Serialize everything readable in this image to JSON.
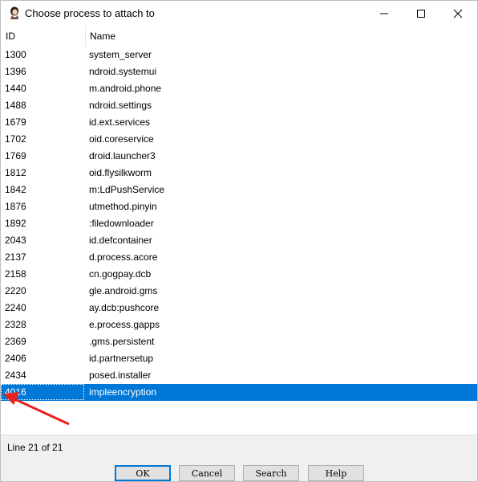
{
  "window": {
    "title": "Choose process to attach to"
  },
  "table": {
    "columns": [
      "ID",
      "Name"
    ],
    "rows": [
      {
        "id": "1300",
        "name": "system_server"
      },
      {
        "id": "1396",
        "name": "ndroid.systemui"
      },
      {
        "id": "1440",
        "name": "m.android.phone"
      },
      {
        "id": "1488",
        "name": "ndroid.settings"
      },
      {
        "id": "1679",
        "name": "id.ext.services"
      },
      {
        "id": "1702",
        "name": "oid.coreservice"
      },
      {
        "id": "1769",
        "name": "droid.launcher3"
      },
      {
        "id": "1812",
        "name": "oid.flysilkworm"
      },
      {
        "id": "1842",
        "name": "m:LdPushService"
      },
      {
        "id": "1876",
        "name": "utmethod.pinyin"
      },
      {
        "id": "1892",
        "name": ":filedownloader"
      },
      {
        "id": "2043",
        "name": "id.defcontainer"
      },
      {
        "id": "2137",
        "name": "d.process.acore"
      },
      {
        "id": "2158",
        "name": "cn.gogpay.dcb"
      },
      {
        "id": "2220",
        "name": "gle.android.gms"
      },
      {
        "id": "2240",
        "name": "ay.dcb:pushcore"
      },
      {
        "id": "2328",
        "name": "e.process.gapps"
      },
      {
        "id": "2369",
        "name": ".gms.persistent"
      },
      {
        "id": "2406",
        "name": "id.partnersetup"
      },
      {
        "id": "2434",
        "name": "posed.installer"
      },
      {
        "id": "4016",
        "name": "impleencryption"
      }
    ],
    "selected_index": 20
  },
  "status": {
    "line_text": "Line 21 of 21"
  },
  "buttons": {
    "ok": "OK",
    "cancel": "Cancel",
    "search": "Search",
    "help": "Help"
  },
  "colors": {
    "selection": "#0078d7",
    "annotation_arrow": "#e8231e"
  },
  "icons": {
    "app": "app-avatar-icon",
    "minimize": "minimize-icon",
    "maximize": "maximize-icon",
    "close": "close-icon"
  }
}
